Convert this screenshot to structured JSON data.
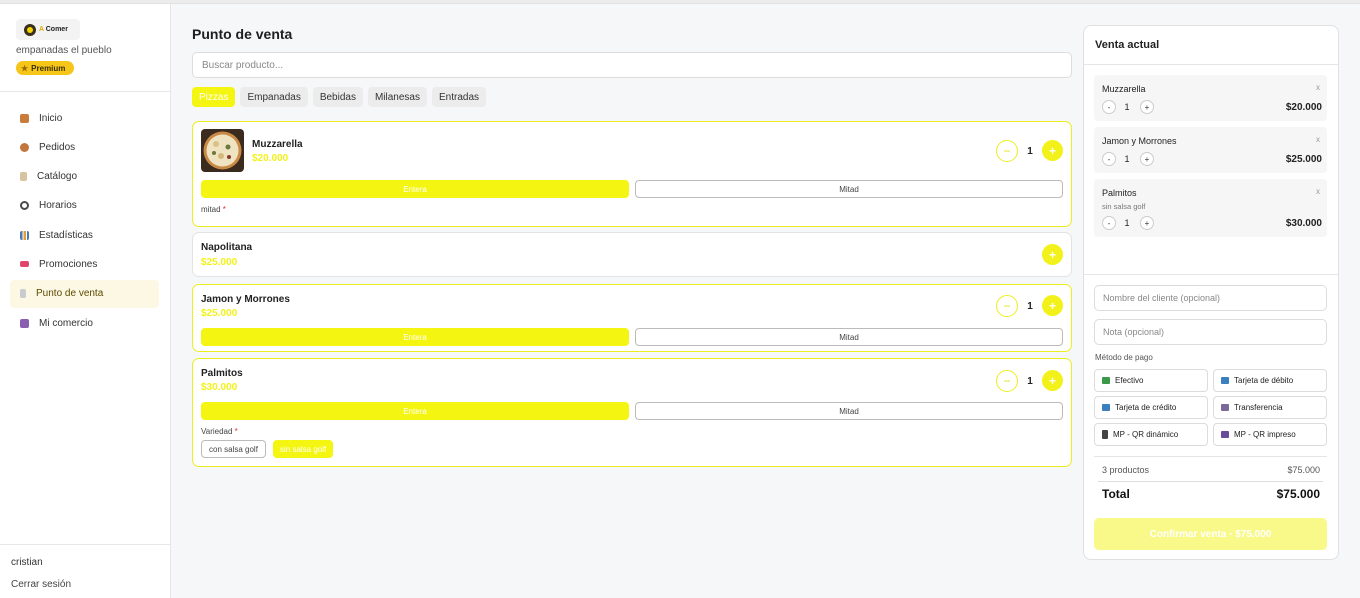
{
  "sidebar": {
    "brand_prefix": "A",
    "brand_name": "Comer",
    "shop_name": "empanadas el pueblo",
    "plan_badge": "Premium",
    "nav": [
      {
        "label": "Inicio",
        "icon": "home-icon",
        "color": "#c97c3a"
      },
      {
        "label": "Pedidos",
        "icon": "box-icon",
        "color": "#c2763e"
      },
      {
        "label": "Catálogo",
        "icon": "clipboard-icon",
        "color": "#b5894a"
      },
      {
        "label": "Horarios",
        "icon": "clock-icon",
        "color": "#4a4a4a"
      },
      {
        "label": "Estadísticas",
        "icon": "bar-chart-icon",
        "color": "#4c7ab5"
      },
      {
        "label": "Promociones",
        "icon": "ticket-icon",
        "color": "#e0456a"
      },
      {
        "label": "Punto de venta",
        "icon": "receipt-icon",
        "color": "#9aa0a6"
      },
      {
        "label": "Mi comercio",
        "icon": "store-icon",
        "color": "#8b5fb0"
      }
    ],
    "active_item": "Punto de venta",
    "user": "cristian",
    "logout": "Cerrar sesión"
  },
  "main": {
    "title": "Punto de venta",
    "search_placeholder": "Buscar producto...",
    "tabs": [
      "Pizzas",
      "Empanadas",
      "Bebidas",
      "Milanesas",
      "Entradas"
    ],
    "active_tab": "Pizzas",
    "products": [
      {
        "name": "Muzzarella",
        "price": "$20.000",
        "qty": "1",
        "opt_whole": "Entera",
        "opt_half": "Mitad",
        "note_label": "mitad",
        "required_mark": "*"
      },
      {
        "name": "Napolitana",
        "price": "$25.000"
      },
      {
        "name": "Jamon y Morrones",
        "price": "$25.000",
        "qty": "1",
        "opt_whole": "Entera",
        "opt_half": "Mitad"
      },
      {
        "name": "Palmitos",
        "price": "$30.000",
        "qty": "1",
        "opt_whole": "Entera",
        "opt_half": "Mitad",
        "variety_label": "Variedad",
        "required_mark": "*",
        "chips": [
          "con salsa golf",
          "sin salsa golf"
        ]
      }
    ],
    "minus": "−",
    "plus": "+"
  },
  "cart": {
    "title": "Venta actual",
    "items": [
      {
        "name": "Muzzarella",
        "qty": "1",
        "price": "$20.000",
        "note": ""
      },
      {
        "name": "Jamon y Morrones",
        "qty": "1",
        "price": "$25.000",
        "note": ""
      },
      {
        "name": "Palmitos",
        "qty": "1",
        "price": "$30.000",
        "note": "sin salsa golf"
      }
    ],
    "remove": "x",
    "minus": "-",
    "plus": "+",
    "customer_placeholder": "Nombre del cliente (opcional)",
    "note_placeholder": "Nota (opcional)",
    "payment_label": "Método de pago",
    "payment_methods": [
      {
        "label": "Efectivo",
        "icon": "cash-icon",
        "color": "#3a9a4a"
      },
      {
        "label": "Tarjeta de débito",
        "icon": "card-icon",
        "color": "#3a7fc0"
      },
      {
        "label": "Tarjeta de crédito",
        "icon": "card-icon",
        "color": "#3a7fc0"
      },
      {
        "label": "Transferencia",
        "icon": "bank-icon",
        "color": "#7a6a9a"
      },
      {
        "label": "MP - QR dinámico",
        "icon": "phone-icon",
        "color": "#444444"
      },
      {
        "label": "MP - QR impreso",
        "icon": "printer-icon",
        "color": "#6a4a9a"
      }
    ],
    "products_count": "3 productos",
    "subtotal": "$75.000",
    "total_label": "Total",
    "total": "$75.000",
    "confirm": "Confirmar venta · $75.000"
  },
  "colors": {
    "accent": "#f5f512",
    "premium": "#f5c518",
    "active_nav_bg": "#fdf8e4"
  }
}
